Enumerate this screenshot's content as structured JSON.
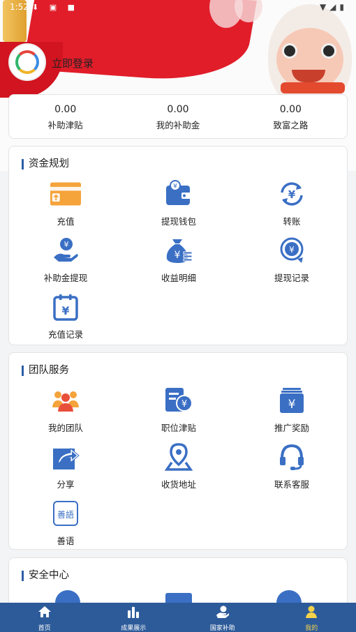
{
  "status_bar": {
    "time": "1:52"
  },
  "profile": {
    "login_label": "立即登录"
  },
  "stats": [
    {
      "value": "0.00",
      "label": "补助津贴"
    },
    {
      "value": "0.00",
      "label": "我的补助金"
    },
    {
      "value": "0.00",
      "label": "致富之路"
    }
  ],
  "funds": {
    "title": "资金规划",
    "items": [
      {
        "label": "充值",
        "icon": "recharge-card-icon"
      },
      {
        "label": "提现钱包",
        "icon": "wallet-icon"
      },
      {
        "label": "转账",
        "icon": "transfer-icon"
      },
      {
        "label": "补助金提现",
        "icon": "hand-coin-icon"
      },
      {
        "label": "收益明细",
        "icon": "money-bag-icon"
      },
      {
        "label": "提现记录",
        "icon": "withdraw-record-icon"
      },
      {
        "label": "充值记录",
        "icon": "calendar-yen-icon"
      }
    ]
  },
  "team": {
    "title": "团队服务",
    "items": [
      {
        "label": "我的团队",
        "icon": "team-icon"
      },
      {
        "label": "职位津贴",
        "icon": "position-allowance-icon"
      },
      {
        "label": "推广奖励",
        "icon": "promotion-reward-icon"
      },
      {
        "label": "分享",
        "icon": "share-icon"
      },
      {
        "label": "收货地址",
        "icon": "location-icon"
      },
      {
        "label": "联系客服",
        "icon": "headset-icon"
      },
      {
        "label": "善语",
        "icon": "shanyu-icon"
      }
    ]
  },
  "security": {
    "title": "安全中心"
  },
  "tabs": [
    {
      "label": "首页",
      "icon": "home-icon"
    },
    {
      "label": "成果展示",
      "icon": "bar-chart-icon"
    },
    {
      "label": "国家补助",
      "icon": "subsidy-icon"
    },
    {
      "label": "我的",
      "icon": "user-icon"
    }
  ],
  "colors": {
    "primary": "#2d5b9a",
    "icon_blue": "#3a6fc4",
    "accent_yellow": "#f4d24a",
    "orange": "#f5a33b"
  }
}
